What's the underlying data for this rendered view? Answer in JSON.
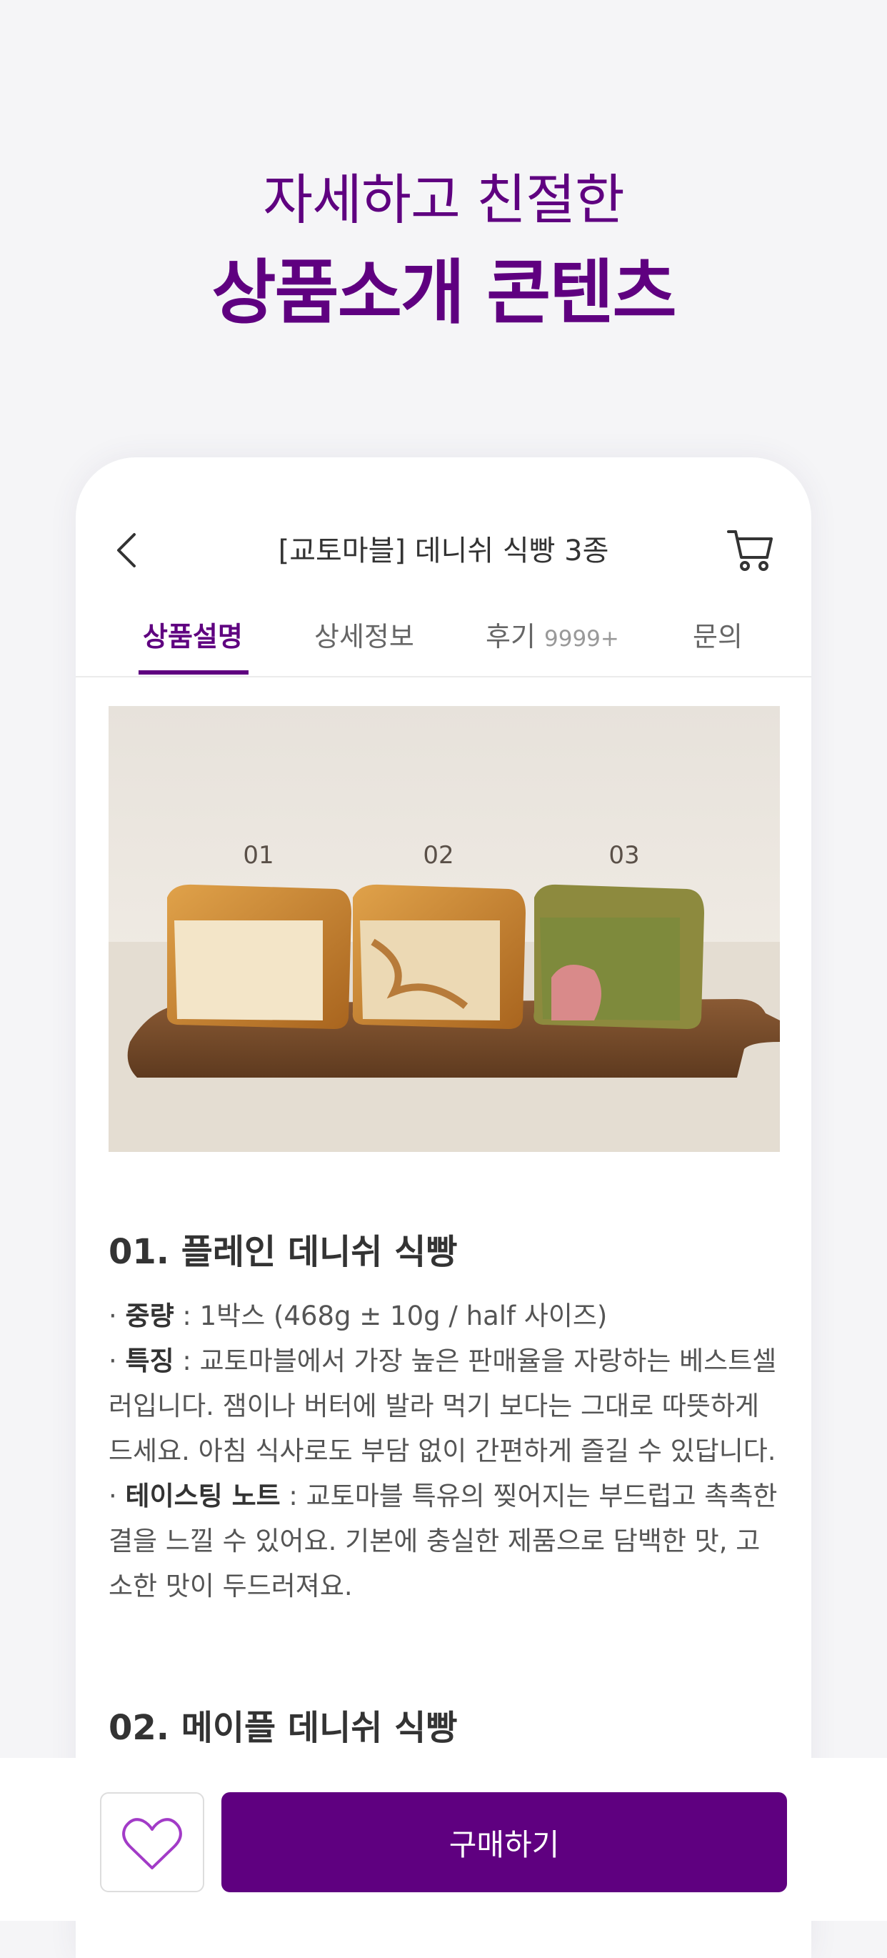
{
  "promo": {
    "subtitle": "자세하고 친절한",
    "title": "상품소개 콘텐츠"
  },
  "header": {
    "title": "[교토마블] 데니쉬 식빵 3종",
    "back_icon": "chevron-left-icon",
    "cart_icon": "cart-icon"
  },
  "tabs": [
    {
      "label": "상품설명"
    },
    {
      "label": "상세정보"
    },
    {
      "label": "후기",
      "count": "9999+"
    },
    {
      "label": "문의"
    }
  ],
  "hero": {
    "labels": [
      "01",
      "02",
      "03"
    ]
  },
  "products": [
    {
      "title": "01. 플레인 데니쉬 식빵",
      "weight_label": "중량",
      "weight_value": " : 1박스 (468g ± 10g / half 사이즈)",
      "feature_label": "특징",
      "feature_line1": " : 교토마블에서 가장 높은 판매율을 자랑하는 베스트셀",
      "feature_line2": "러입니다. 잼이나 버터에 발라 먹기 보다는 그대로 따뜻하게",
      "feature_line3": "드세요. 아침 식사로도 부담 없이 간편하게 즐길 수 있답니다.",
      "tasting_label": "테이스팅 노트",
      "tasting_line1": " : 교토마블 특유의 찢어지는 부드럽고 촉촉한",
      "tasting_line2": "결을 느낄 수 있어요. 기본에 충실한 제품으로 담백한 맛, 고",
      "tasting_line3": "소한 맛이 두드러져요."
    },
    {
      "title": "02. 메이플 데니쉬 식빵"
    }
  ],
  "bottom": {
    "like_icon": "heart-icon",
    "buy_label": "구매하기"
  },
  "colors": {
    "brand": "#5f0080",
    "background": "#f5f5f7"
  }
}
